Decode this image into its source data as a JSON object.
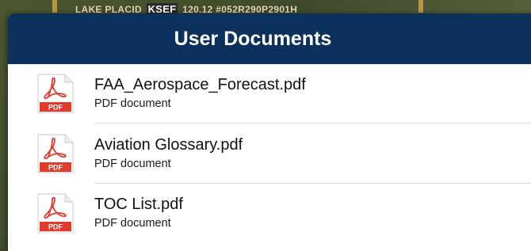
{
  "background": {
    "map_label": "LAKE PLACID",
    "map_code": "KSEF",
    "map_freq": "120.12",
    "map_trailing": "#052R290P2901H"
  },
  "panel": {
    "title": "User Documents",
    "header_color": "#0d315d"
  },
  "documents": [
    {
      "name": "FAA_Aerospace_Forecast.pdf",
      "type": "PDF document",
      "icon": "pdf-file-icon",
      "badge": "PDF"
    },
    {
      "name": "Aviation Glossary.pdf",
      "type": "PDF document",
      "icon": "pdf-file-icon",
      "badge": "PDF"
    },
    {
      "name": "TOC List.pdf",
      "type": "PDF document",
      "icon": "pdf-file-icon",
      "badge": "PDF"
    }
  ],
  "colors": {
    "pdf_red": "#e23b2e",
    "divider": "#dcdcdc"
  }
}
